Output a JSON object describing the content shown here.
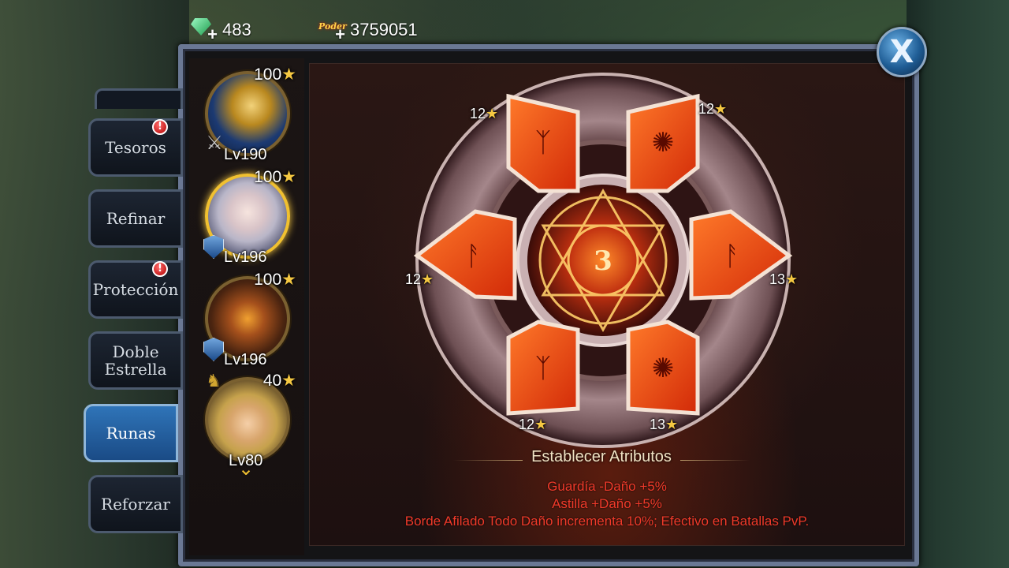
{
  "resources": {
    "gems": {
      "value": "483",
      "icon": "gem-icon"
    },
    "power": {
      "badge": "Poder",
      "value": "3759051",
      "icon": "power-icon"
    }
  },
  "close_label": "X",
  "tabs": [
    {
      "label": "Tesoros",
      "alert": "!"
    },
    {
      "label": "Refinar"
    },
    {
      "label": "Protección",
      "alert": "!"
    },
    {
      "label": "Doble Estrella"
    },
    {
      "label": "Runas",
      "active": true
    },
    {
      "label": "Reforzar"
    }
  ],
  "heroes": [
    {
      "stars": "100",
      "level": "Lv190",
      "badge": "swords-icon"
    },
    {
      "stars": "100",
      "level": "Lv196",
      "badge": "shield-icon",
      "selected": true
    },
    {
      "stars": "100",
      "level": "Lv196",
      "badge": "shield-icon"
    },
    {
      "stars": "40",
      "level": "Lv80",
      "badge": "horse-icon"
    }
  ],
  "star_glyph": "★",
  "center_rank": "3",
  "runes": [
    {
      "position": "top-left",
      "level": "12"
    },
    {
      "position": "top-right",
      "level": "12"
    },
    {
      "position": "left",
      "level": "12"
    },
    {
      "position": "right",
      "level": "13"
    },
    {
      "position": "bottom-left",
      "level": "12"
    },
    {
      "position": "bottom-right",
      "level": "13"
    }
  ],
  "attributes": {
    "title": "Establecer Atributos",
    "lines": [
      "Guardía  -Daño +5%",
      "Astilla  +Daño +5%",
      "Borde Afilado  Todo Daño incrementa 10%; Efectivo en Batallas PvP."
    ]
  },
  "colors": {
    "accent": "#2f74b8",
    "rune": "#e8481a",
    "attr_text": "#f03a2a",
    "star": "#f5c842"
  }
}
